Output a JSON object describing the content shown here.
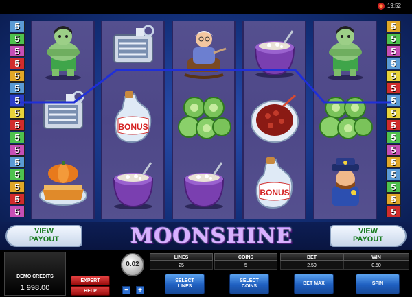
{
  "topbar": {
    "clock": "19:52",
    "settings_icon": "settings-icon"
  },
  "game": {
    "logo_text": "MOONSHINE"
  },
  "paylines": {
    "left": [
      {
        "value": "5",
        "color": "#5b9bd5"
      },
      {
        "value": "5",
        "color": "#4ec24e"
      },
      {
        "value": "5",
        "color": "#c64fb5"
      },
      {
        "value": "5",
        "color": "#d12c2c"
      },
      {
        "value": "5",
        "color": "#e0a728"
      },
      {
        "value": "5",
        "color": "#5b9bd5"
      },
      {
        "value": "5",
        "color": "#2d3fc9"
      },
      {
        "value": "5",
        "color": "#e7d33a"
      },
      {
        "value": "5",
        "color": "#d12c2c"
      },
      {
        "value": "5",
        "color": "#4ec24e"
      },
      {
        "value": "5",
        "color": "#c64fb5"
      },
      {
        "value": "5",
        "color": "#5b9bd5"
      },
      {
        "value": "5",
        "color": "#4ec24e"
      },
      {
        "value": "5",
        "color": "#e0a728"
      },
      {
        "value": "5",
        "color": "#d12c2c"
      },
      {
        "value": "5",
        "color": "#c64fb5"
      }
    ],
    "right": [
      {
        "value": "5",
        "color": "#e0a728"
      },
      {
        "value": "5",
        "color": "#4ec24e"
      },
      {
        "value": "5",
        "color": "#c64fb5"
      },
      {
        "value": "5",
        "color": "#5b9bd5"
      },
      {
        "value": "5",
        "color": "#e7d33a"
      },
      {
        "value": "5",
        "color": "#d12c2c"
      },
      {
        "value": "5",
        "color": "#5b9bd5"
      },
      {
        "value": "5",
        "color": "#e7d33a"
      },
      {
        "value": "5",
        "color": "#d12c2c"
      },
      {
        "value": "5",
        "color": "#4ec24e"
      },
      {
        "value": "5",
        "color": "#c64fb5"
      },
      {
        "value": "5",
        "color": "#e0a728"
      },
      {
        "value": "5",
        "color": "#5b9bd5"
      },
      {
        "value": "5",
        "color": "#4ec24e"
      },
      {
        "value": "5",
        "color": "#e0a728"
      },
      {
        "value": "5",
        "color": "#d12c2c"
      }
    ]
  },
  "reels": [
    [
      "hillbilly",
      "moonshine-can",
      "pumpkin-pie"
    ],
    [
      "moonshine-can",
      "bonus-jug",
      "bean-pot"
    ],
    [
      "granny",
      "pickles",
      "bean-pot"
    ],
    [
      "bean-pot",
      "beans-bowl",
      "bonus-jug"
    ],
    [
      "hillbilly",
      "pickles",
      "sheriff"
    ]
  ],
  "symbol_text": {
    "bonus": "BONUS"
  },
  "payout_buttons": {
    "left_label": "VIEW\nPAYOUT",
    "right_label": "VIEW\nPAYOUT"
  },
  "controls": {
    "credits_title": "DEMO CREDITS",
    "credits_value": "1 998.00",
    "expert_label": "EXPERT",
    "help_label": "HELP",
    "coin_value": "0.02",
    "coin_minus": "−",
    "coin_plus": "+",
    "lines_label": "LINES",
    "lines_value": "25",
    "coins_label": "COINS",
    "coins_value": "5",
    "bet_label": "BET",
    "bet_value": "2.50",
    "win_label": "WIN",
    "win_value": "0.50",
    "select_lines_label": "SELECT\nLINES",
    "select_coins_label": "SELECT\nCOINS",
    "bet_max_label": "BET MAX",
    "spin_label": "SPIN"
  }
}
